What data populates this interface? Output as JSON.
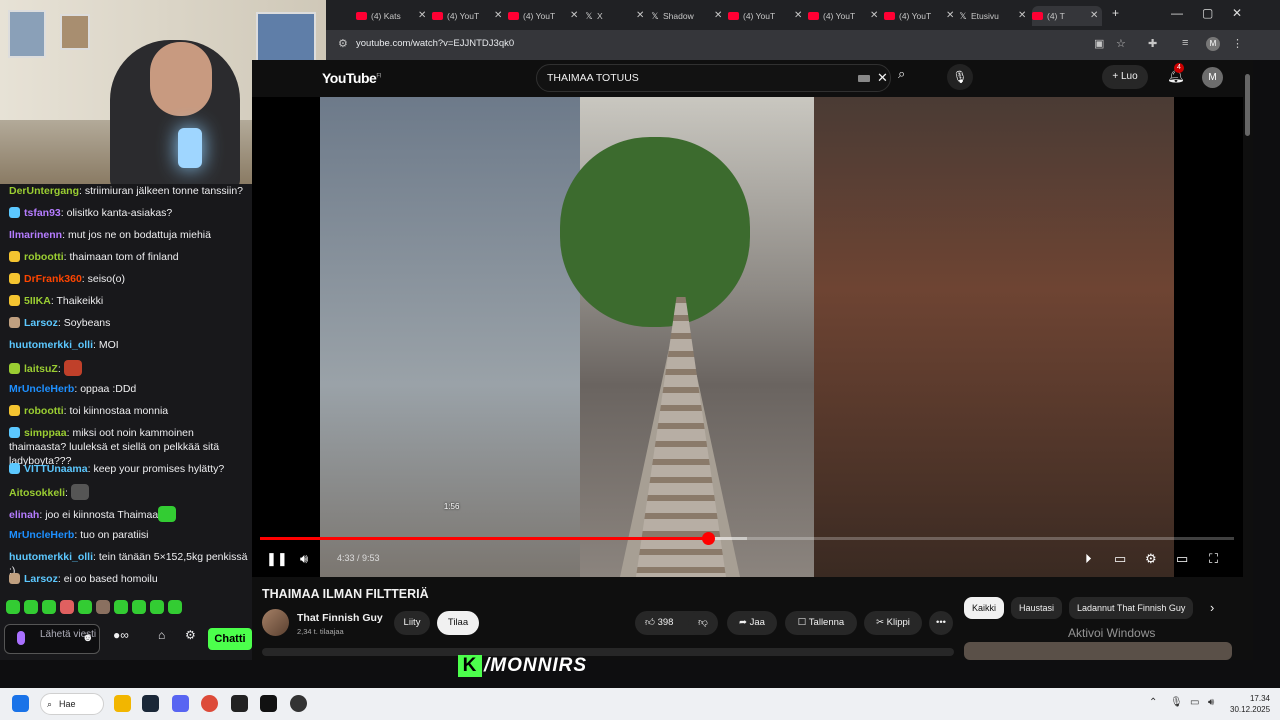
{
  "browser": {
    "tabs": [
      {
        "title": "(4) Kats",
        "fav": "yt"
      },
      {
        "title": "(4) YouT",
        "fav": "yt"
      },
      {
        "title": "(4) YouT",
        "fav": "yt"
      },
      {
        "title": "X",
        "fav": "x"
      },
      {
        "title": "Shadow",
        "fav": "x"
      },
      {
        "title": "(4) YouT",
        "fav": "yt"
      },
      {
        "title": "(4) YouT",
        "fav": "yt"
      },
      {
        "title": "(4) YouT",
        "fav": "yt"
      },
      {
        "title": "Etusivu",
        "fav": "x"
      },
      {
        "title": "(4) T",
        "fav": "yt"
      }
    ],
    "url": "youtube.com/watch?v=EJJNTDJ3qk0",
    "profile_initial": "M"
  },
  "youtube": {
    "logo": "YouTube",
    "region": "FI",
    "search_value": "THAIMAA TOTUUS",
    "create_label": "Luo",
    "notifications": "4",
    "avatar_initial": "M",
    "hover_time": "1:56",
    "time": "4:33 / 9:53",
    "progress_played": 0.46,
    "progress_buffered": 0.5,
    "hover_position": 0.197,
    "video_title": "THAIMAA ILMAN FILTTERIÄ",
    "channel_name": "That Finnish Guy",
    "subscribers": "2,34 t. tilaajaa",
    "join_label": "Liity",
    "subscribe_label": "Tilaa",
    "likes": "398",
    "share_label": "Jaa",
    "save_label": "Tallenna",
    "clip_label": "Klippi",
    "chips": [
      "Kaikki",
      "Haustasi",
      "Ladannut That Finnish Guy"
    ],
    "activate_windows": "Aktivoi Windows"
  },
  "chat": {
    "messages": [
      {
        "user": "DerUntergang",
        "color": "#9acd32",
        "text": "striimiuran jälkeen tonne tanssiin?"
      },
      {
        "user": "tsfan93",
        "color": "#b57cff",
        "text": "olisitko kanta-asiakas?"
      },
      {
        "user": "Ilmarinenn",
        "color": "#b57cff",
        "text": "mut jos ne on bodattuja miehiä"
      },
      {
        "user": "robootti",
        "color": "#9acd32",
        "text": "thaimaan tom of finland"
      },
      {
        "user": "DrFrank360",
        "color": "#ff4500",
        "text": "seiso(o)"
      },
      {
        "user": "5IIKA",
        "color": "#9acd32",
        "text": "Thaikeikki"
      },
      {
        "user": "Larsoz",
        "color": "#5cc8ff",
        "text": "Soybeans"
      },
      {
        "user": "huutomerkki_olli",
        "color": "#5cc8ff",
        "text": "MOI"
      },
      {
        "user": "laitsuZ",
        "color": "#9acd32",
        "text": ""
      },
      {
        "user": "MrUncleHerb",
        "color": "#1e90ff",
        "text": "oppaa :DDd"
      },
      {
        "user": "robootti",
        "color": "#9acd32",
        "text": "toi kiinnostaa monnia"
      },
      {
        "user": "simppaa",
        "color": "#9acd32",
        "text": "miksi oot noin kammoinen thaimaasta? luuleksä et siellä on pelkkää sitä ladyboyta???"
      },
      {
        "user": "VITTUnaama",
        "color": "#5cc8ff",
        "text": "keep your promises hylätty?"
      },
      {
        "user": "Aitosokkeli",
        "color": "#9acd32",
        "text": ""
      },
      {
        "user": "elinah",
        "color": "#b57cff",
        "text": "joo ei kiinnosta Thaimaa"
      },
      {
        "user": "MrUncleHerb",
        "color": "#1e90ff",
        "text": "tuo on paratiisi"
      },
      {
        "user": "huutomerkki_olli",
        "color": "#5cc8ff",
        "text": "tein tänään 5×152,5kg penkissä :)"
      },
      {
        "user": "Larsoz",
        "color": "#5cc8ff",
        "text": "ei oo based homoilu"
      }
    ],
    "input_placeholder": "Lähetä viesti",
    "chat_button": "Chatti"
  },
  "overlay": {
    "brand": "/MONNIRS",
    "brand_letter": "K"
  },
  "taskbar": {
    "search_label": "Hae",
    "time": "17.34",
    "date": "30.12.2025"
  }
}
